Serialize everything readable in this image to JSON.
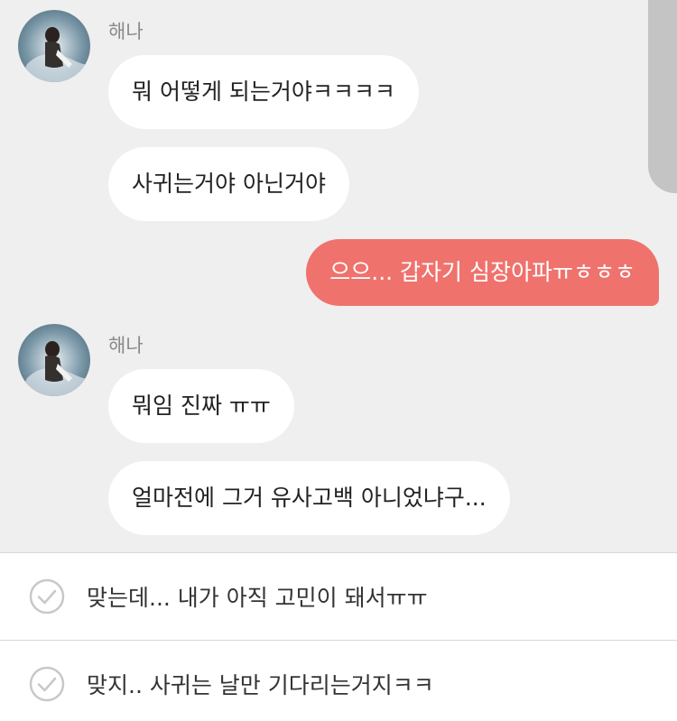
{
  "chat": {
    "messages": [
      {
        "sender": "해나",
        "text": "뭐 어떻게 되는거야ㅋㅋㅋㅋ"
      },
      {
        "text": "사귀는거야 아닌거야"
      },
      {
        "mine": true,
        "text": "으으... 갑자기 심장아파ㅠㅎㅎㅎ"
      },
      {
        "sender": "해나",
        "text": "뭐임 진짜 ㅠㅠ"
      },
      {
        "text": "얼마전에 그거 유사고백 아니었냐구..."
      }
    ]
  },
  "reply_options": [
    {
      "label": "맞는데... 내가 아직 고민이 돼서ㅠㅠ"
    },
    {
      "label": "맞지.. 사귀는 날만 기다리는거지ㅋㅋ"
    }
  ],
  "colors": {
    "background": "#efefef",
    "my_bubble": "#ef726d",
    "other_bubble": "#ffffff",
    "check_icon": "#c8c8c8"
  }
}
